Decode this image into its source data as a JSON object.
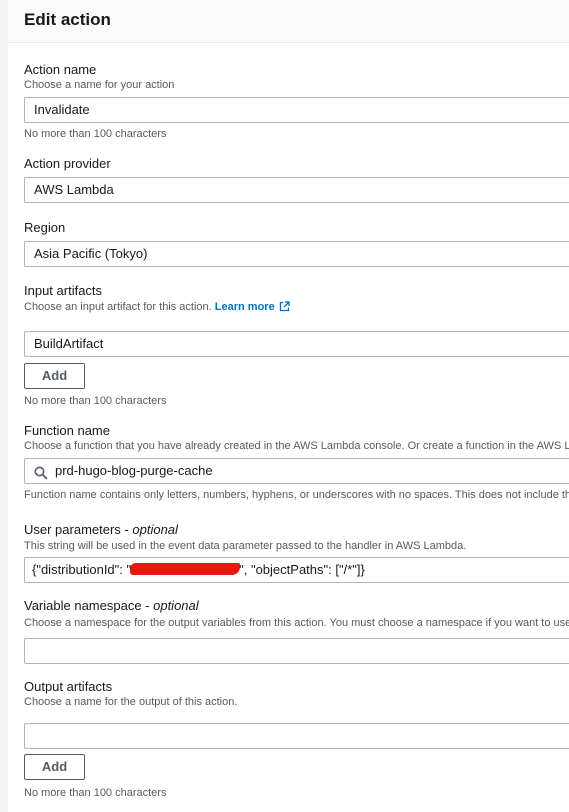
{
  "header": {
    "title": "Edit action"
  },
  "action_name": {
    "label": "Action name",
    "description": "Choose a name for your action",
    "value": "Invalidate",
    "constraint": "No more than 100 characters"
  },
  "action_provider": {
    "label": "Action provider",
    "value": "AWS Lambda"
  },
  "region": {
    "label": "Region",
    "value": "Asia Pacific (Tokyo)"
  },
  "input_artifacts": {
    "label": "Input artifacts",
    "description": "Choose an input artifact for this action.",
    "learn_more": "Learn more",
    "value": "BuildArtifact",
    "add_button": "Add",
    "constraint": "No more than 100 characters"
  },
  "function_name": {
    "label": "Function name",
    "description": "Choose a function that you have already created in the AWS Lambda console. Or create a function in the AWS La",
    "value": "prd-hugo-blog-purge-cache",
    "constraint": "Function name contains only letters, numbers, hyphens, or underscores with no spaces. This does not include th"
  },
  "user_parameters": {
    "label": "User parameters - ",
    "optional": "optional",
    "description": "This string will be used in the event data parameter passed to the handler in AWS Lambda.",
    "value_prefix": "{\"distributionId\": \"",
    "value_suffix": "\", \"objectPaths\": [\"/*\"]}"
  },
  "variable_namespace": {
    "label": "Variable namespace - ",
    "optional": "optional",
    "description": "Choose a namespace for the output variables from this action. You must choose a namespace if you want to use",
    "value": ""
  },
  "output_artifacts": {
    "label": "Output artifacts",
    "description": "Choose a name for the output of this action.",
    "value": "",
    "add_button": "Add",
    "constraint": "No more than 100 characters"
  },
  "colors": {
    "link": "#0073bb",
    "redaction": "#e8170f",
    "border": "#aab7b8"
  }
}
